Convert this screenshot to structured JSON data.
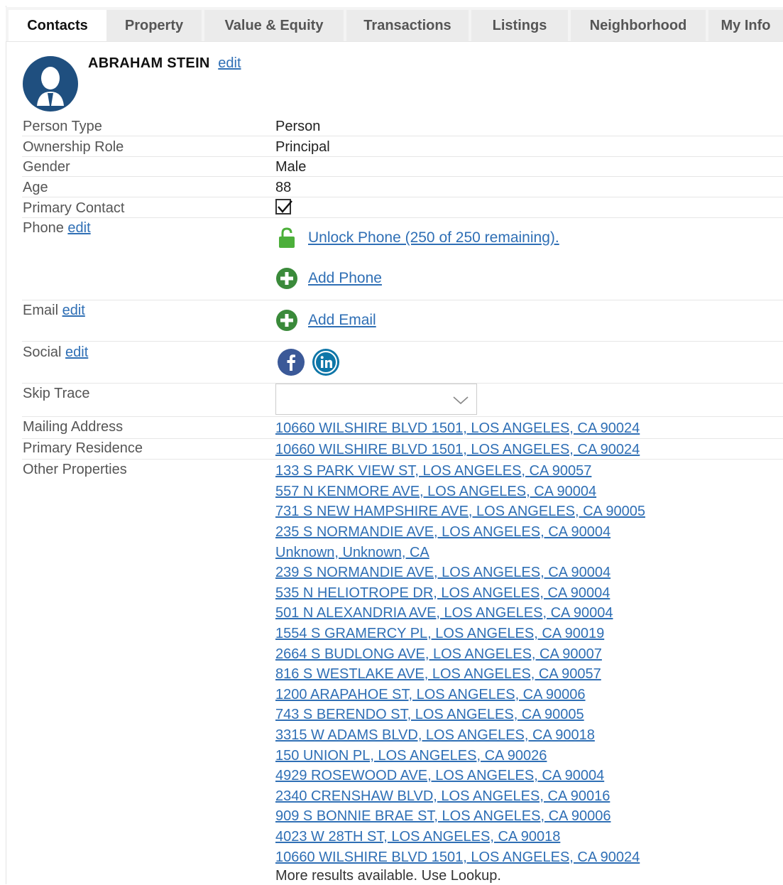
{
  "tabs": [
    "Contacts",
    "Property",
    "Value & Equity",
    "Transactions",
    "Listings",
    "Neighborhood",
    "My Info"
  ],
  "contact": {
    "name": "ABRAHAM STEIN",
    "edit_label": "edit"
  },
  "fields": {
    "person_type": {
      "label": "Person Type",
      "value": "Person"
    },
    "ownership_role": {
      "label": "Ownership Role",
      "value": "Principal"
    },
    "gender": {
      "label": "Gender",
      "value": "Male"
    },
    "age": {
      "label": "Age",
      "value": "88"
    },
    "primary_contact": {
      "label": "Primary Contact",
      "checked": true
    },
    "phone": {
      "label": "Phone",
      "edit_label": "edit",
      "unlock_label": "Unlock Phone (250 of 250 remaining).",
      "add_label": "Add Phone"
    },
    "email": {
      "label": "Email",
      "edit_label": "edit",
      "add_label": "Add Email"
    },
    "social": {
      "label": "Social",
      "edit_label": "edit",
      "icons": [
        "facebook-icon",
        "linkedin-icon"
      ]
    },
    "skip_trace": {
      "label": "Skip Trace",
      "value": ""
    },
    "mailing_address": {
      "label": "Mailing Address",
      "value": "10660 WILSHIRE BLVD 1501, LOS ANGELES, CA 90024"
    },
    "primary_residence": {
      "label": "Primary Residence",
      "value": "10660 WILSHIRE BLVD 1501, LOS ANGELES, CA 90024"
    },
    "other_properties": {
      "label": "Other Properties",
      "items": [
        "133 S PARK VIEW ST, LOS ANGELES, CA 90057",
        "557 N KENMORE AVE, LOS ANGELES, CA 90004",
        "731 S NEW HAMPSHIRE AVE, LOS ANGELES, CA 90005",
        "235 S NORMANDIE AVE, LOS ANGELES, CA 90004",
        "Unknown, Unknown, CA",
        "239 S NORMANDIE AVE, LOS ANGELES, CA 90004",
        "535 N HELIOTROPE DR, LOS ANGELES, CA 90004",
        "501 N ALEXANDRIA AVE, LOS ANGELES, CA 90004",
        "1554 S GRAMERCY PL, LOS ANGELES, CA 90019",
        "2664 S BUDLONG AVE, LOS ANGELES, CA 90007",
        "816 S WESTLAKE AVE, LOS ANGELES, CA 90057",
        "1200 ARAPAHOE ST, LOS ANGELES, CA 90006",
        "743 S BERENDO ST, LOS ANGELES, CA 90005",
        "3315 W ADAMS BLVD, LOS ANGELES, CA 90018",
        "150 UNION PL, LOS ANGELES, CA 90026",
        "4929 ROSEWOOD AVE, LOS ANGELES, CA 90004",
        "2340 CRENSHAW BLVD, LOS ANGELES, CA 90016",
        "909 S BONNIE BRAE ST, LOS ANGELES, CA 90006",
        "4023 W 28TH ST, LOS ANGELES, CA 90018",
        "10660 WILSHIRE BLVD 1501, LOS ANGELES, CA 90024"
      ],
      "more_text": "More results available. Use Lookup."
    }
  },
  "colors": {
    "link": "#2f6fb5",
    "add_green": "#3a8a3a",
    "lock_green": "#4caf3a",
    "avatar_blue": "#1f4f7f",
    "facebook": "#3b5998",
    "linkedin": "#0e76a8"
  }
}
